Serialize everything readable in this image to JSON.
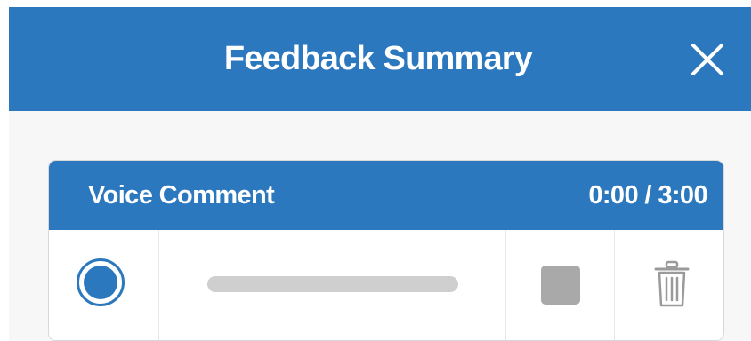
{
  "header": {
    "title": "Feedback Summary",
    "close_icon": "close-icon"
  },
  "voice_comment": {
    "title": "Voice Comment",
    "time": "0:00 / 3:00",
    "progress": 0,
    "icons": {
      "record": "record-icon",
      "stop": "stop-icon",
      "delete": "trash-icon"
    }
  },
  "colors": {
    "accent": "#2b78be",
    "panel_background": "#f7f7f7",
    "track": "#cfcfcf",
    "stop": "#a9a9a9"
  }
}
